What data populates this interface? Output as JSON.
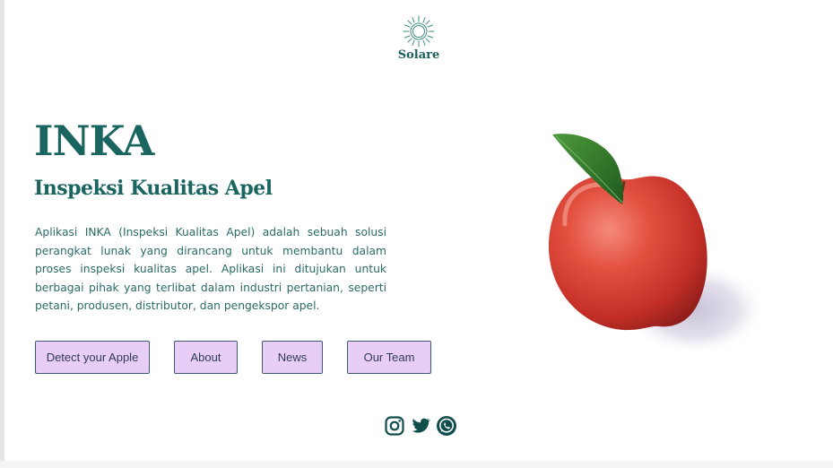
{
  "brand": {
    "name": "Solare",
    "logo_icon": "sun-icon",
    "color": "#1a5e5a"
  },
  "hero": {
    "title": "INKA",
    "subtitle": "Inspeksi Kualitas Apel",
    "description": "Aplikasi INKA (Inspeksi Kualitas Apel) adalah sebuah solusi perangkat lunak yang dirancang untuk membantu dalam proses inspeksi kualitas apel. Aplikasi ini ditujukan untuk berbagai pihak yang terlibat dalam industri pertanian, seperti petani, produsen, distributor, dan pengekspor apel."
  },
  "nav_buttons": {
    "detect": "Detect your Apple",
    "about": "About",
    "news": "News",
    "team": "Our Team"
  },
  "image": {
    "subject": "red apple with green leaf"
  },
  "social": {
    "icons": [
      "instagram-icon",
      "twitter-icon",
      "whatsapp-icon"
    ]
  },
  "colors": {
    "accent": "#1a6560",
    "button_bg": "#e8cdf6",
    "button_border": "#3d5a78"
  }
}
